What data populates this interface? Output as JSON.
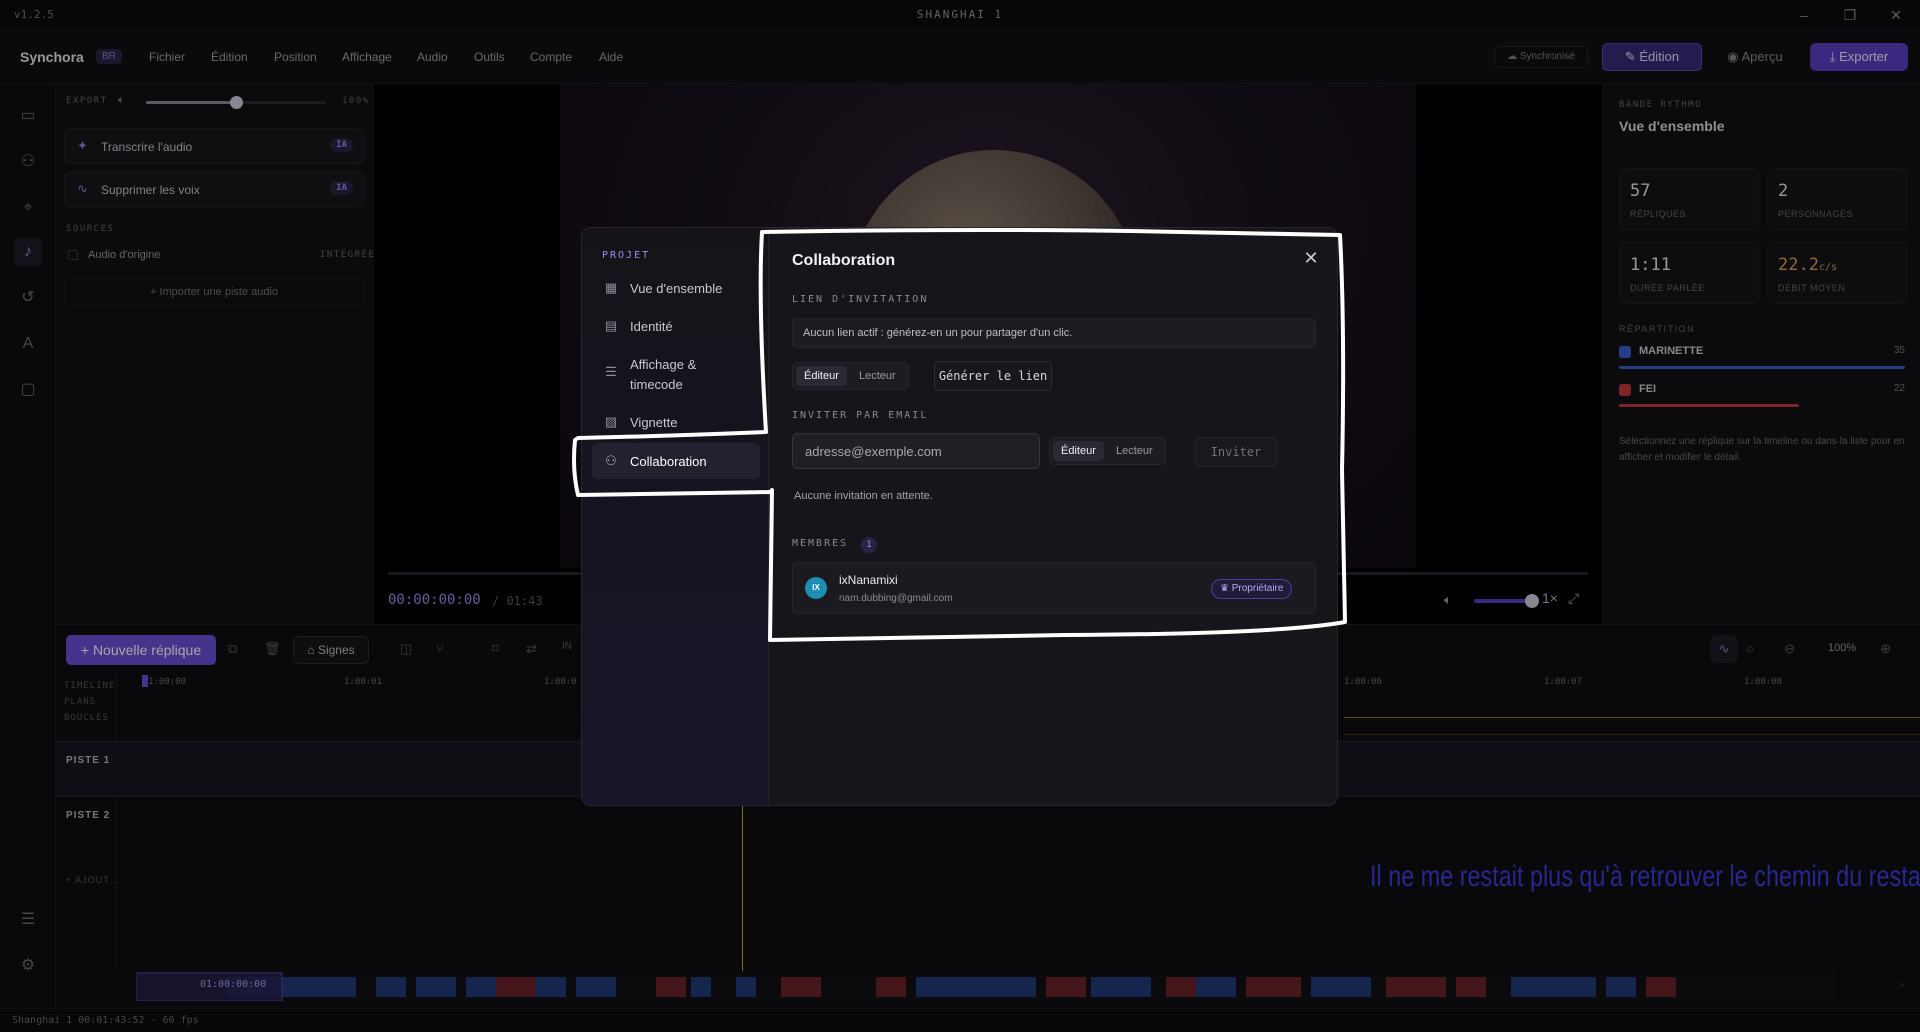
{
  "app": {
    "version": "v1.2.5",
    "window_title": "SHANGHAI 1",
    "brand": "Synchora",
    "brand_badge": "BR"
  },
  "menu": [
    "Fichier",
    "Édition",
    "Position",
    "Affichage",
    "Audio",
    "Outils",
    "Compte",
    "Aide"
  ],
  "header_actions": {
    "sync": "Synchronisé",
    "edit": "Édition",
    "preview": "Aperçu",
    "export": "Exporter"
  },
  "left_panel": {
    "export_label": "EXPORT",
    "volume_percent": "100%",
    "volume_level": 0.5,
    "ai_actions": [
      {
        "label": "Transcrire l'audio",
        "badge": "IA"
      },
      {
        "label": "Supprimer les voix",
        "badge": "IA"
      }
    ],
    "sources_label": "SOURCES",
    "source_name": "Audio d'origine",
    "source_state": "INTÉGRÉE",
    "import_label": "Importer une piste audio"
  },
  "player": {
    "timecode": "00:00:00:00",
    "duration": "/ 01:43",
    "speed": "1×"
  },
  "right_panel": {
    "section": "BANDE RYTHMO",
    "title": "Vue d'ensemble",
    "stats": [
      {
        "value": "57",
        "label": "RÉPLIQUES"
      },
      {
        "value": "2",
        "label": "PERSONNAGES"
      },
      {
        "value": "1:11",
        "label": "DURÉE PARLÉE"
      },
      {
        "value": "22.2",
        "unit": "c/s",
        "label": "DÉBIT MOYEN"
      }
    ],
    "distribution_label": "RÉPARTITION",
    "characters": [
      {
        "name": "MARINETTE",
        "count": "35",
        "color": "#3a5fd0"
      },
      {
        "name": "FEI",
        "count": "22",
        "color": "#c0393f"
      }
    ],
    "hint": "Sélectionnez une réplique sur la timeline ou dans la liste pour en afficher et modifier le détail."
  },
  "timeline": {
    "new_reply": "Nouvelle réplique",
    "signs": "Signes",
    "in_label": "IN",
    "zoom": "100%",
    "side_labels": [
      "TIMELINE",
      "PLANS",
      "BOUCLES"
    ],
    "ruler": [
      "1:00:00",
      "1:00:01",
      "1:00:0",
      "1:00:06",
      "1:00:07",
      "1:00:08"
    ],
    "tracks": [
      "PISTE 1",
      "PISTE 2"
    ],
    "add_track": "AJOUT…",
    "subtitle": "Il ne me restait plus qu'à retrouver le chemin du restaurant",
    "minimap_timecode": "01:00:00:00"
  },
  "status": "Shanghai 1  00:01:43:52 · 60 fps",
  "modal": {
    "nav_heading": "PROJET",
    "nav_items": [
      {
        "label": "Vue d'ensemble",
        "icon": "grid-icon"
      },
      {
        "label": "Identité",
        "icon": "id-card-icon"
      },
      {
        "label": "Affichage & timecode",
        "icon": "sliders-icon"
      },
      {
        "label": "Vignette",
        "icon": "image-icon"
      },
      {
        "label": "Collaboration",
        "icon": "users-icon"
      }
    ],
    "title": "Collaboration",
    "invite_link_label": "LIEN D'INVITATION",
    "invite_link_text": "Aucun lien actif : générez-en un pour partager d'un clic.",
    "role_editor": "Éditeur",
    "role_reader": "Lecteur",
    "generate_link": "Générer le lien",
    "invite_email_label": "INVITER PAR EMAIL",
    "email_placeholder": "adresse@exemple.com",
    "invite_button": "Inviter",
    "no_pending": "Aucune invitation en attente.",
    "members_label": "MEMBRES",
    "members_count": "1",
    "member": {
      "initials": "IX",
      "name": "ixNanamixi",
      "email": "nam.dubbing@gmail.com",
      "role": "Propriétaire"
    }
  }
}
